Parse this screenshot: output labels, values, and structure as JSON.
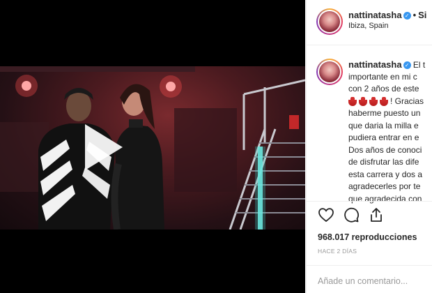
{
  "post": {
    "username": "nattinatasha",
    "follow_label": "Si",
    "location": "Ibiza, Spain",
    "caption_lines": [
      "El t",
      "importante en mi c",
      "con 2 años de este",
      "! Gracias",
      "haberme puesto un",
      "que daria la milla e",
      "pudiera entrar en e",
      "Dos años de conoci",
      "de disfrutar las dife",
      "esta carrera y dos a",
      "agradecerles por te",
      "que agradecida con"
    ],
    "views_text": "968.017 reproducciones",
    "time_ago": "HACE 2 DÍAS",
    "comment_placeholder": "Añade un comentario...",
    "icons": {
      "like": "heart-icon",
      "comment": "comment-icon",
      "share": "share-icon",
      "verified": "verified-badge-icon",
      "play": "play-icon"
    },
    "colors": {
      "verified": "#3897f0",
      "meta_text": "#999999",
      "divider": "#efefef"
    }
  }
}
